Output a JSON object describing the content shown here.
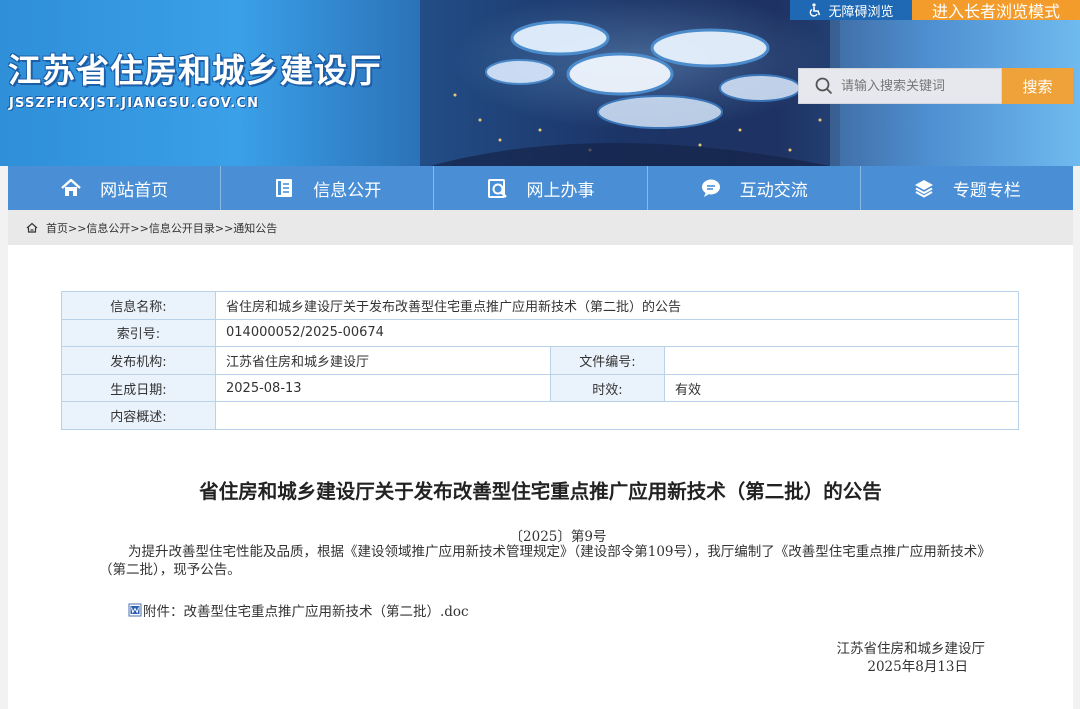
{
  "header": {
    "site_title": "江苏省住房和城乡建设厅",
    "site_domain": "JSSZFHCXJST.JIANGSU.GOV.CN",
    "accessibility_label": "无障碍浏览",
    "elder_mode_label": "进入长者浏览模式",
    "search_placeholder": "请输入搜索关键词",
    "search_button": "搜索"
  },
  "nav": {
    "items": [
      {
        "label": "网站首页",
        "icon": "home-icon"
      },
      {
        "label": "信息公开",
        "icon": "document-icon"
      },
      {
        "label": "网上办事",
        "icon": "service-search-icon"
      },
      {
        "label": "互动交流",
        "icon": "chat-icon"
      },
      {
        "label": "专题专栏",
        "icon": "layers-icon"
      }
    ]
  },
  "breadcrumb": {
    "icon": "home-outline-icon",
    "text": "首页>>信息公开>>信息公开目录>>通知公告"
  },
  "meta": {
    "name_label": "信息名称:",
    "name_value": "省住房和城乡建设厅关于发布改善型住宅重点推广应用新技术（第二批）的公告",
    "index_label": "索引号:",
    "index_value": "014000052/2025-00674",
    "publisher_label": "发布机构:",
    "publisher_value": "江苏省住房和城乡建设厅",
    "file_no_label": "文件编号:",
    "file_no_value": "",
    "date_label": "生成日期:",
    "date_value": "2025-08-13",
    "validity_label": "时效:",
    "validity_value": "有效",
    "summary_label": "内容概述:",
    "summary_value": ""
  },
  "article": {
    "title": "省住房和城乡建设厅关于发布改善型住宅重点推广应用新技术（第二批）的公告",
    "doc_number": "〔2025〕第9号",
    "body": "为提升改善型住宅性能及品质，根据《建设领域推广应用新技术管理规定》（建设部令第109号），我厅编制了《改善型住宅重点推广应用新技术》（第二批），现予公告。",
    "attachment": "附件：改善型住宅重点推广应用新技术（第二批）.doc",
    "signature_org": "江苏省住房和城乡建设厅",
    "signature_date": "2025年8月13日"
  },
  "colors": {
    "nav_bg": "#4a8fd6",
    "search_btn": "#f0a23a",
    "elder_mode_bg": "#f39c2b",
    "table_border": "#b9d2ea",
    "table_label_bg": "#eaf2fb"
  }
}
